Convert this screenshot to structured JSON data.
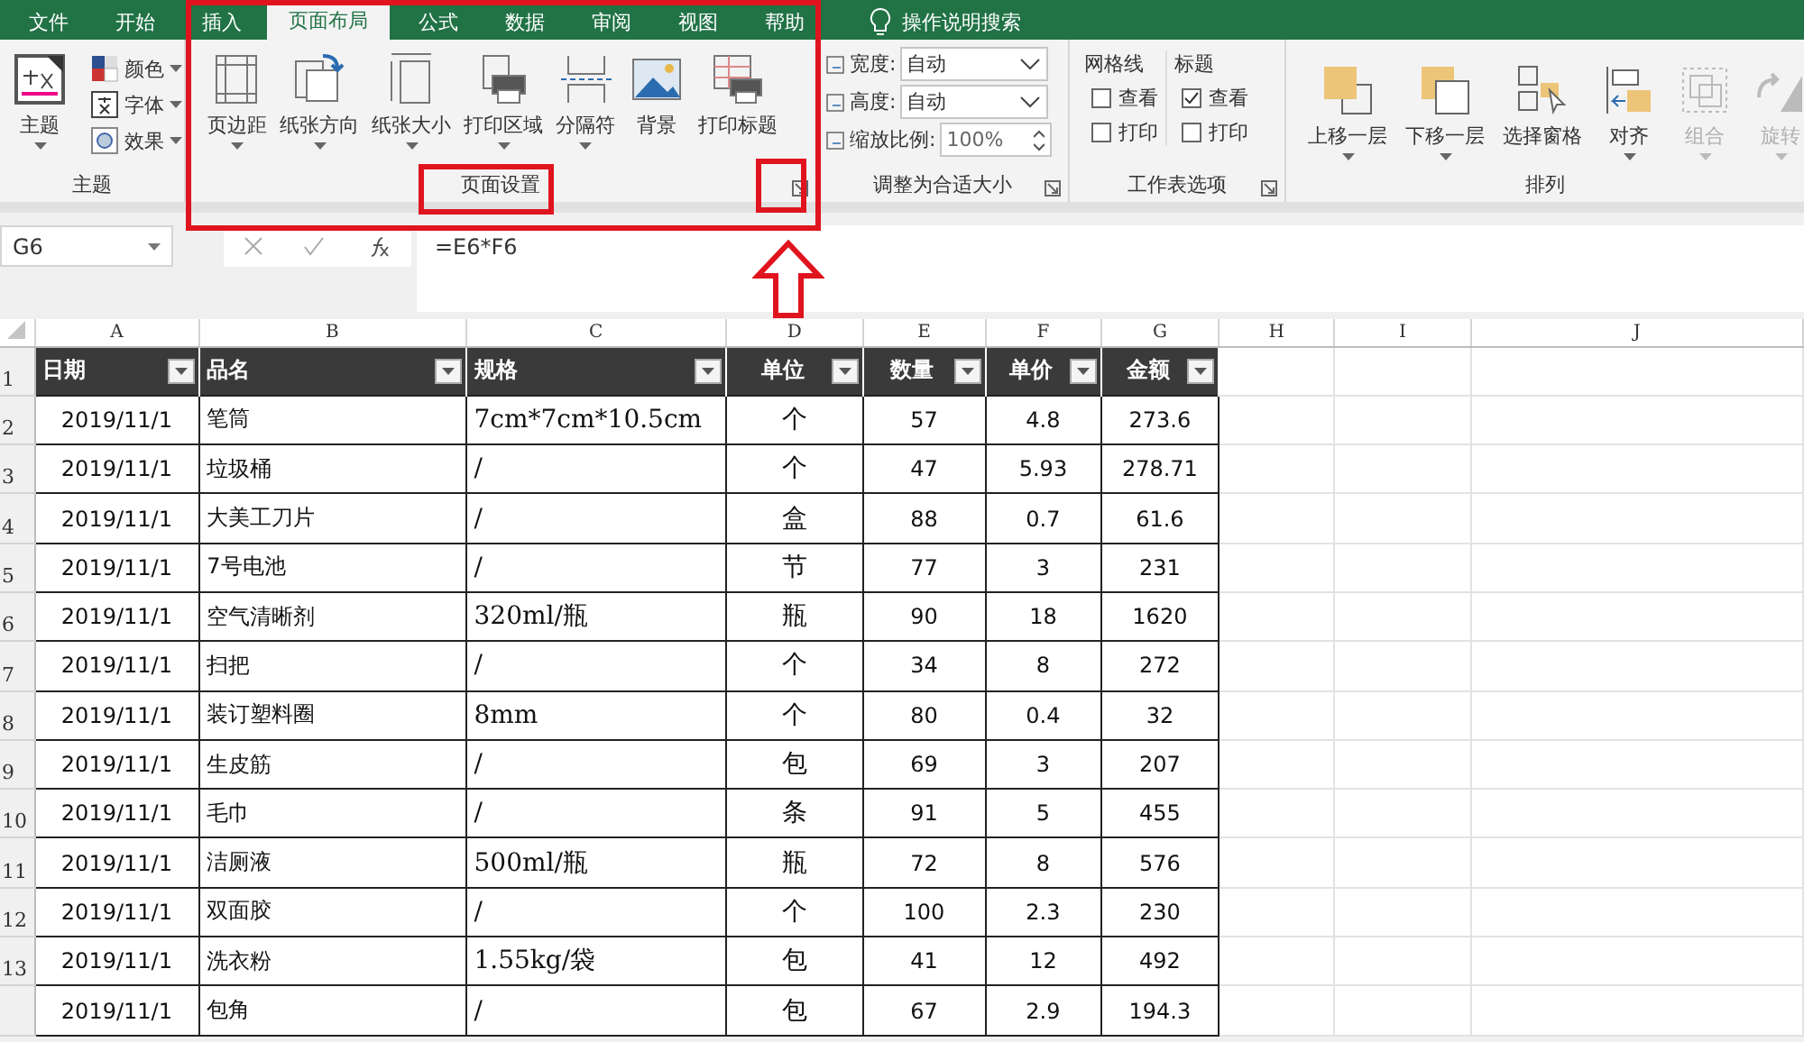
{
  "tabs": [
    {
      "label": "文件",
      "selected": false
    },
    {
      "label": "开始",
      "selected": false
    },
    {
      "label": "插入",
      "selected": false
    },
    {
      "label": "页面布局",
      "selected": true
    },
    {
      "label": "公式",
      "selected": false
    },
    {
      "label": "数据",
      "selected": false
    },
    {
      "label": "审阅",
      "selected": false
    },
    {
      "label": "视图",
      "selected": false
    },
    {
      "label": "帮助",
      "selected": false
    }
  ],
  "tell_me": "操作说明搜索",
  "ribbon": {
    "theme_group": {
      "label": "主题",
      "main": "主题",
      "items": [
        {
          "label": "颜色"
        },
        {
          "label": "字体"
        },
        {
          "label": "效果"
        }
      ]
    },
    "page_setup": {
      "label": "页面设置",
      "buttons": [
        {
          "label": "页边距",
          "caret": true
        },
        {
          "label": "纸张方向",
          "caret": true
        },
        {
          "label": "纸张大小",
          "caret": true
        },
        {
          "label": "打印区域",
          "caret": true
        },
        {
          "label": "分隔符",
          "caret": true
        },
        {
          "label": "背景",
          "caret": false
        },
        {
          "label": "打印标题",
          "caret": false
        }
      ]
    },
    "scale": {
      "label": "调整为合适大小",
      "fields": [
        {
          "label": "宽度:",
          "value": "自动",
          "kind": "dropdown"
        },
        {
          "label": "高度:",
          "value": "自动",
          "kind": "dropdown"
        },
        {
          "label": "缩放比例:",
          "value": "100%",
          "kind": "spinner"
        }
      ]
    },
    "sheet_options": {
      "label": "工作表选项",
      "columns": [
        {
          "title": "网格线",
          "options": [
            {
              "label": "查看",
              "checked": false
            },
            {
              "label": "打印",
              "checked": false
            }
          ]
        },
        {
          "title": "标题",
          "options": [
            {
              "label": "查看",
              "checked": true
            },
            {
              "label": "打印",
              "checked": false
            }
          ]
        }
      ]
    },
    "arrange": {
      "label": "排列",
      "buttons": [
        {
          "label": "上移一层",
          "caret": true,
          "disabled": false
        },
        {
          "label": "下移一层",
          "caret": true,
          "disabled": false
        },
        {
          "label": "选择窗格",
          "caret": false,
          "disabled": false
        },
        {
          "label": "对齐",
          "caret": true,
          "disabled": false
        },
        {
          "label": "组合",
          "caret": true,
          "disabled": true
        },
        {
          "label": "旋转",
          "caret": true,
          "disabled": true
        }
      ]
    }
  },
  "formula_bar": {
    "name_box": "G6",
    "formula": "=E6*F6"
  },
  "sheet": {
    "columns": [
      "A",
      "B",
      "C",
      "D",
      "E",
      "F",
      "G",
      "H",
      "I",
      "J"
    ],
    "header": {
      "number": "1",
      "cells": [
        "日期",
        "品名",
        "规格",
        "单位",
        "数量",
        "单价",
        "金额"
      ]
    },
    "rows": [
      {
        "number": "2",
        "cells": [
          "2019/11/1",
          "笔筒",
          "7cm*7cm*10.5cm",
          "个",
          "57",
          "4.8",
          "273.6"
        ]
      },
      {
        "number": "3",
        "cells": [
          "2019/11/1",
          "垃圾桶",
          "/",
          "个",
          "47",
          "5.93",
          "278.71"
        ]
      },
      {
        "number": "4",
        "cells": [
          "2019/11/1",
          "大美工刀片",
          "/",
          "盒",
          "88",
          "0.7",
          "61.6"
        ]
      },
      {
        "number": "5",
        "cells": [
          "2019/11/1",
          "7号电池",
          "/",
          "节",
          "77",
          "3",
          "231"
        ]
      },
      {
        "number": "6",
        "cells": [
          "2019/11/1",
          "空气清晰剂",
          "320ml/瓶",
          "瓶",
          "90",
          "18",
          "1620"
        ]
      },
      {
        "number": "7",
        "cells": [
          "2019/11/1",
          "扫把",
          "/",
          "个",
          "34",
          "8",
          "272"
        ]
      },
      {
        "number": "8",
        "cells": [
          "2019/11/1",
          "装订塑料圈",
          "8mm",
          "个",
          "80",
          "0.4",
          "32"
        ]
      },
      {
        "number": "9",
        "cells": [
          "2019/11/1",
          "生皮筋",
          "/",
          "包",
          "69",
          "3",
          "207"
        ]
      },
      {
        "number": "10",
        "cells": [
          "2019/11/1",
          "毛巾",
          "/",
          "条",
          "91",
          "5",
          "455"
        ]
      },
      {
        "number": "11",
        "cells": [
          "2019/11/1",
          "洁厕液",
          "500ml/瓶",
          "瓶",
          "72",
          "8",
          "576"
        ]
      },
      {
        "number": "12",
        "cells": [
          "2019/11/1",
          "双面胶",
          "/",
          "个",
          "100",
          "2.3",
          "230"
        ]
      },
      {
        "number": "13",
        "cells": [
          "2019/11/1",
          "洗衣粉",
          "1.55kg/袋",
          "包",
          "41",
          "12",
          "492"
        ]
      },
      {
        "cells": [
          "2019/11/1",
          "包角",
          "/",
          "包",
          "67",
          "2.9",
          "194.3"
        ]
      }
    ]
  }
}
